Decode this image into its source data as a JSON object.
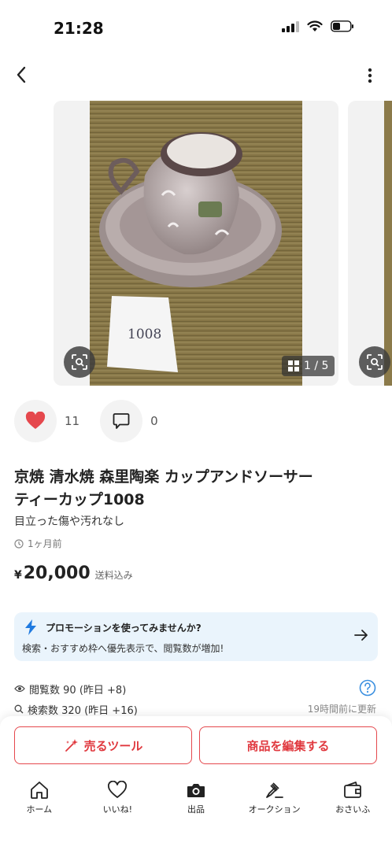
{
  "status_bar": {
    "time": "21:28"
  },
  "gallery": {
    "counter": "1 / 5",
    "photo_note": "1008"
  },
  "reactions": {
    "likes": "11",
    "comments": "0"
  },
  "item": {
    "title_line1": "京焼 清水焼 森里陶楽 カップアンドソーサー",
    "title_line2": "ティーカップ1008",
    "condition": "目立った傷や汚れなし",
    "posted": "1ヶ月前",
    "price_symbol": "¥",
    "price": "20,000",
    "price_note": "送料込み"
  },
  "promo": {
    "title": "プロモーションを使ってみませんか?",
    "description": "検索・おすすめ枠へ優先表示で、閲覧数が増加!"
  },
  "stats": {
    "views_label": "閲覧数",
    "views_value": "90 (昨日 +8)",
    "search_label": "検索数",
    "search_value": "320 (昨日 +16)",
    "updated": "19時間前に更新"
  },
  "actions": {
    "sell_tool": "売るツール",
    "edit_item": "商品を編集する"
  },
  "tabs": [
    {
      "label": "ホーム",
      "icon": "home-icon"
    },
    {
      "label": "いいね!",
      "icon": "heart-outline-icon"
    },
    {
      "label": "出品",
      "icon": "camera-icon"
    },
    {
      "label": "オークション",
      "icon": "auction-hammer-icon"
    },
    {
      "label": "おさいふ",
      "icon": "wallet-icon"
    }
  ],
  "colors": {
    "accent": "#e5484d",
    "like": "#e5484d",
    "promo_bg": "#eaf4fc",
    "promo_icon": "#1f7ae0",
    "help": "#3a8fe0"
  }
}
